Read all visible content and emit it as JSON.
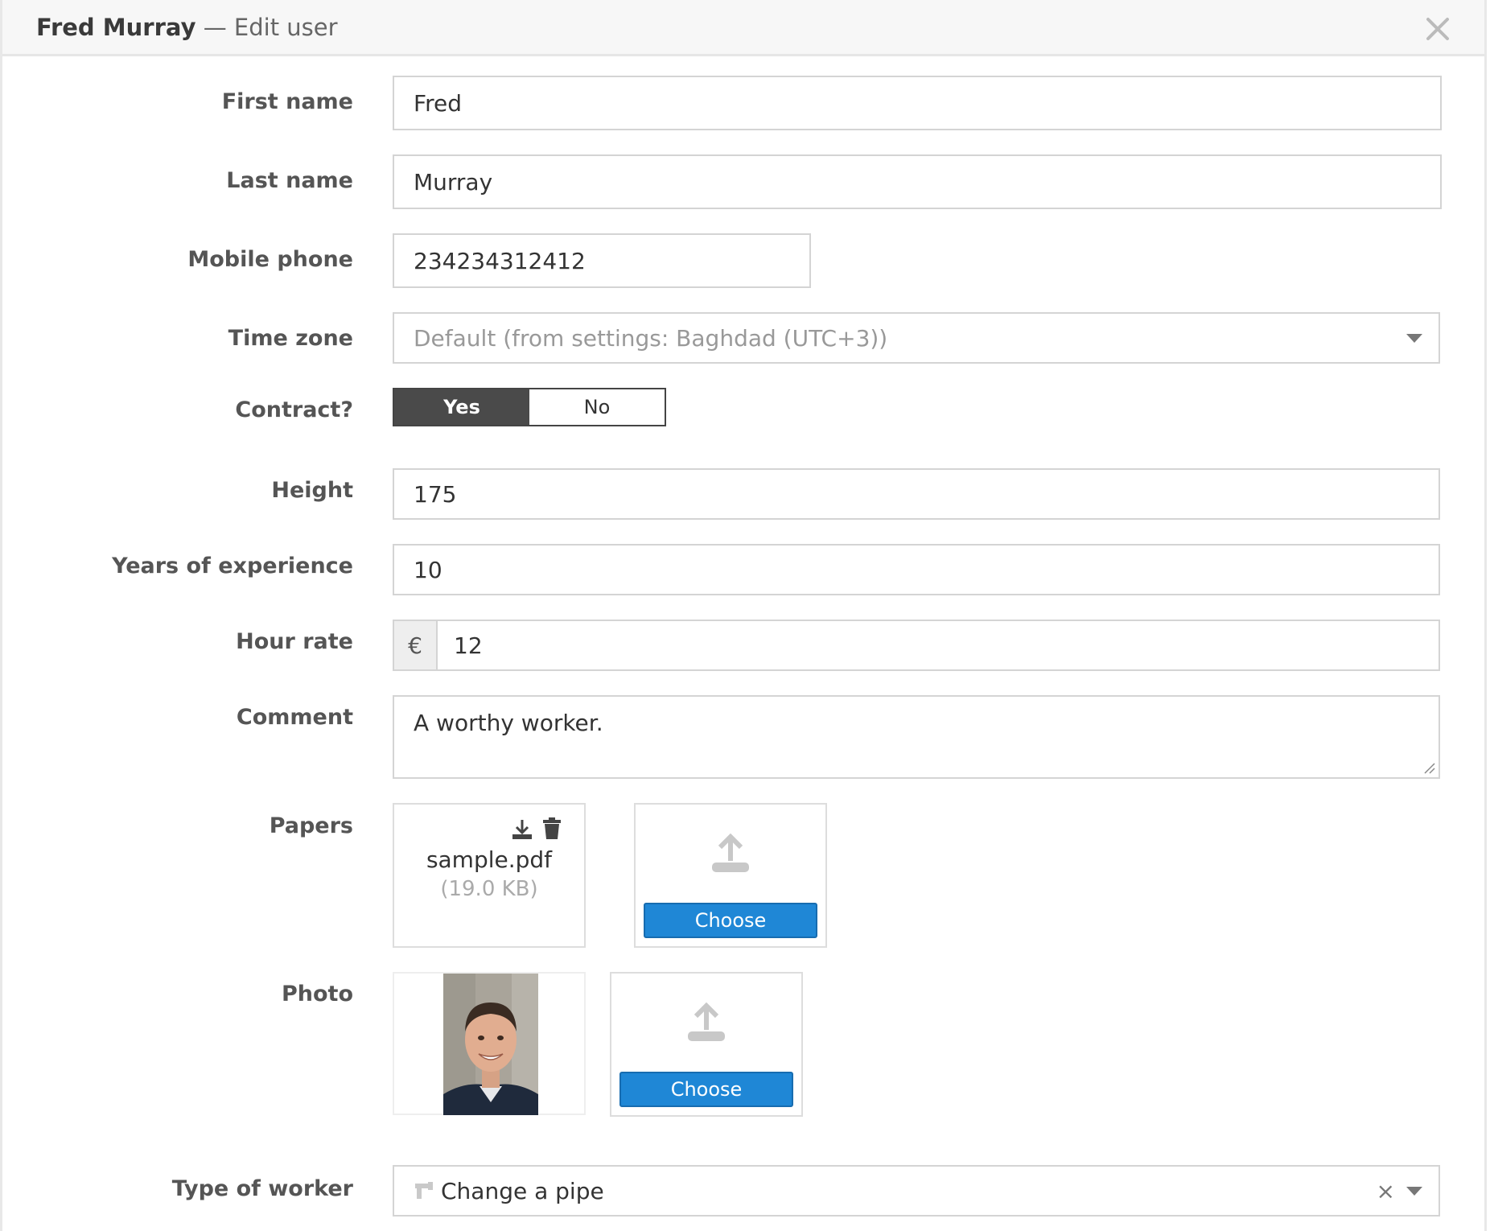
{
  "header": {
    "name": "Fred Murray",
    "subtitle": "— Edit user",
    "close_icon": "close-icon"
  },
  "fields": {
    "first_name": {
      "label": "First name",
      "value": "Fred"
    },
    "last_name": {
      "label": "Last name",
      "value": "Murray"
    },
    "mobile_phone": {
      "label": "Mobile phone",
      "value": "234234312412"
    },
    "time_zone": {
      "label": "Time zone",
      "value": "Default (from settings: Baghdad (UTC+3))"
    },
    "contract": {
      "label": "Contract?",
      "yes": "Yes",
      "no": "No",
      "selected": "Yes"
    },
    "height": {
      "label": "Height",
      "value": "175"
    },
    "years_experience": {
      "label": "Years of experience",
      "value": "10"
    },
    "hour_rate": {
      "label": "Hour rate",
      "currency": "€",
      "value": "12"
    },
    "comment": {
      "label": "Comment",
      "value": "A worthy worker."
    },
    "papers": {
      "label": "Papers",
      "file_name": "sample.pdf",
      "file_size": "(19.0 KB)",
      "choose_label": "Choose"
    },
    "photo": {
      "label": "Photo",
      "choose_label": "Choose"
    },
    "type_of_worker": {
      "label": "Type of worker",
      "value": "Change a pipe",
      "clear": "×"
    }
  },
  "colors": {
    "accent": "#1f87d6",
    "toggle_active": "#4a4a4a"
  }
}
